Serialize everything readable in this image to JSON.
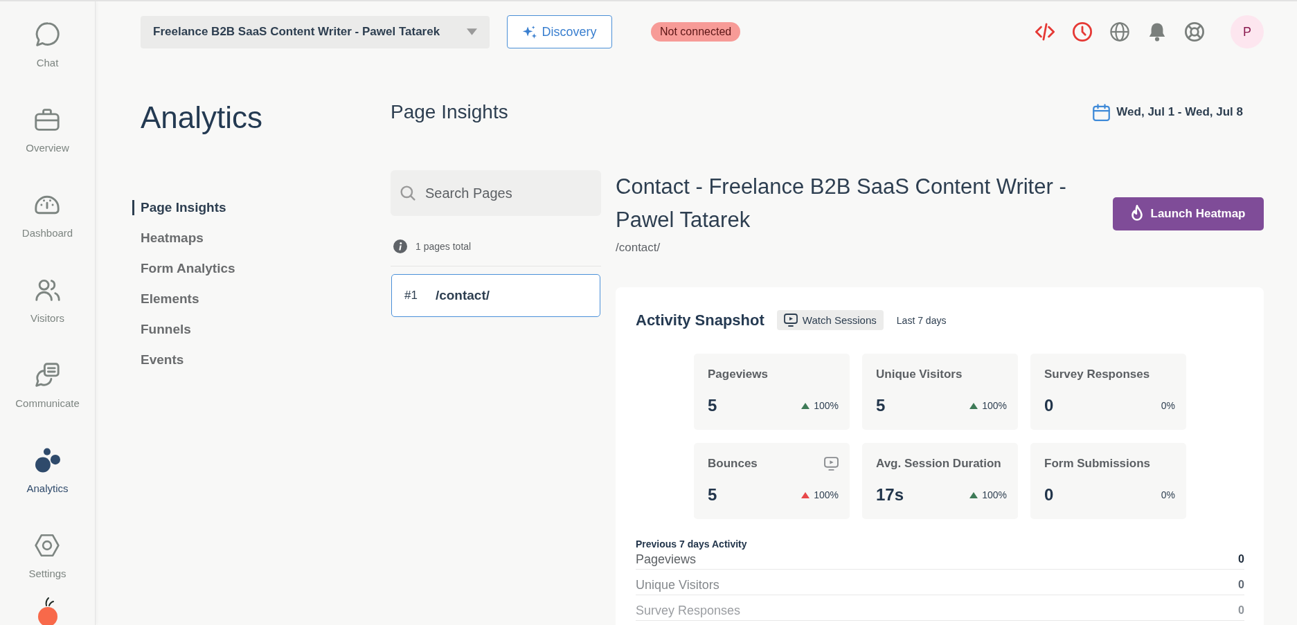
{
  "sidebar": {
    "items": [
      {
        "label": "Chat",
        "kind": "chat",
        "selected": false
      },
      {
        "label": "Overview",
        "kind": "briefcase",
        "selected": false
      },
      {
        "label": "Dashboard",
        "kind": "gauge",
        "selected": false
      },
      {
        "label": "Visitors",
        "kind": "people",
        "selected": false
      },
      {
        "label": "Communicate",
        "kind": "messages",
        "selected": false
      },
      {
        "label": "Analytics",
        "kind": "dots",
        "selected": true
      },
      {
        "label": "Settings",
        "kind": "hexagon",
        "selected": false
      }
    ]
  },
  "topbar": {
    "site_select": {
      "value": "Freelance B2B SaaS Content Writer - Pawel Tatarek"
    },
    "discovery_button": {
      "label": "Discovery"
    },
    "connection_badge": {
      "label": "Not connected"
    },
    "icons": [
      {
        "kind": "code",
        "color": "#e53935"
      },
      {
        "kind": "clock",
        "color": "#e53935"
      },
      {
        "kind": "globe",
        "color": "#7a7f7c"
      },
      {
        "kind": "bell",
        "color": "#7a7f7c"
      },
      {
        "kind": "lifebuoy",
        "color": "#7a7f7c"
      }
    ],
    "avatar": {
      "initial": "P"
    }
  },
  "analytics": {
    "title": "Analytics",
    "nav": [
      {
        "label": "Page Insights",
        "selected": true
      },
      {
        "label": "Heatmaps",
        "selected": false
      },
      {
        "label": "Form Analytics",
        "selected": false
      },
      {
        "label": "Elements",
        "selected": false
      },
      {
        "label": "Funnels",
        "selected": false
      },
      {
        "label": "Events",
        "selected": false
      }
    ]
  },
  "page_insights": {
    "title": "Page Insights",
    "date_range": "Wed, Jul 1 - Wed, Jul 8",
    "search": {
      "placeholder": "Search Pages"
    },
    "pages_total": "1 pages total",
    "pages": [
      {
        "rank": "#1",
        "path": "/contact/",
        "selected": true
      }
    ],
    "detail": {
      "title": "Contact - Freelance B2B SaaS Content Writer - Pawel Tatarek",
      "path": "/contact/",
      "launch_button": "Launch Heatmap"
    },
    "snapshot": {
      "title": "Activity Snapshot",
      "watch_button": "Watch Sessions",
      "period": "Last 7 days",
      "metrics": [
        {
          "label": "Pageviews",
          "value": "5",
          "change": "100%",
          "kind": "increase",
          "color": "#3e7a57",
          "watch_sessions": false
        },
        {
          "label": "Unique Visitors",
          "value": "5",
          "change": "100%",
          "kind": "increase",
          "color": "#3e7a57",
          "watch_sessions": false
        },
        {
          "label": "Survey Responses",
          "value": "0",
          "change": "0%",
          "kind": "flat",
          "watch_sessions": false
        },
        {
          "label": "Bounces",
          "value": "5",
          "change": "100%",
          "kind": "increase",
          "color": "#e8484a",
          "watch_sessions": true
        },
        {
          "label": "Avg. Session Duration",
          "value": "17s",
          "change": "100%",
          "kind": "increase",
          "color": "#3e7a57",
          "watch_sessions": false
        },
        {
          "label": "Form Submissions",
          "value": "0",
          "change": "0%",
          "kind": "flat",
          "watch_sessions": false
        }
      ],
      "previous": {
        "title": "Previous 7 days Activity",
        "rows": [
          {
            "label": "Pageviews",
            "value": "0"
          },
          {
            "label": "Unique Visitors",
            "value": "0"
          },
          {
            "label": "Survey Responses",
            "value": "0"
          }
        ]
      }
    }
  }
}
